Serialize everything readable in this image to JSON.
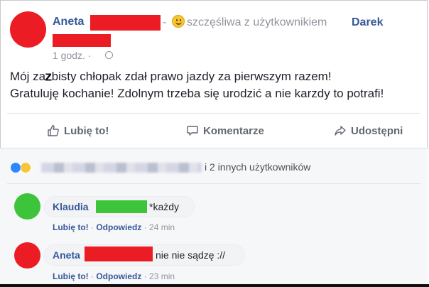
{
  "post": {
    "author": "Aneta",
    "separator": "-",
    "feeling_text": "szczęśliwa z użytkownikiem",
    "feeling_user": "Darek",
    "timestamp": "1 godz. ·",
    "line1_before": "Mój za",
    "line1_scribble": "z",
    "line1_after": "bisty chłopak zdał prawo jazdy za pierwszym razem!",
    "line2": "Gratuluję kochanie! Zdolnym trzeba się urodzić a nie karzdy to potrafi!"
  },
  "actions": {
    "like": "Lubię to!",
    "comment": "Komentarze",
    "share": "Udostępni"
  },
  "reactions": {
    "others_text": "i 2 innych użytkowników"
  },
  "comments": [
    {
      "author": "Klaudia",
      "text": "*każdy",
      "like": "Lubię to!",
      "reply": "Odpowiedz",
      "time": "24 min"
    },
    {
      "author": "Aneta",
      "text": "nie nie sądzę ://",
      "like": "Lubię to!",
      "reply": "Odpowiedz",
      "time": "23 min"
    }
  ],
  "colors": {
    "link": "#365899",
    "redaction_red": "#ec1c24",
    "redaction_green": "#3dc43b"
  }
}
